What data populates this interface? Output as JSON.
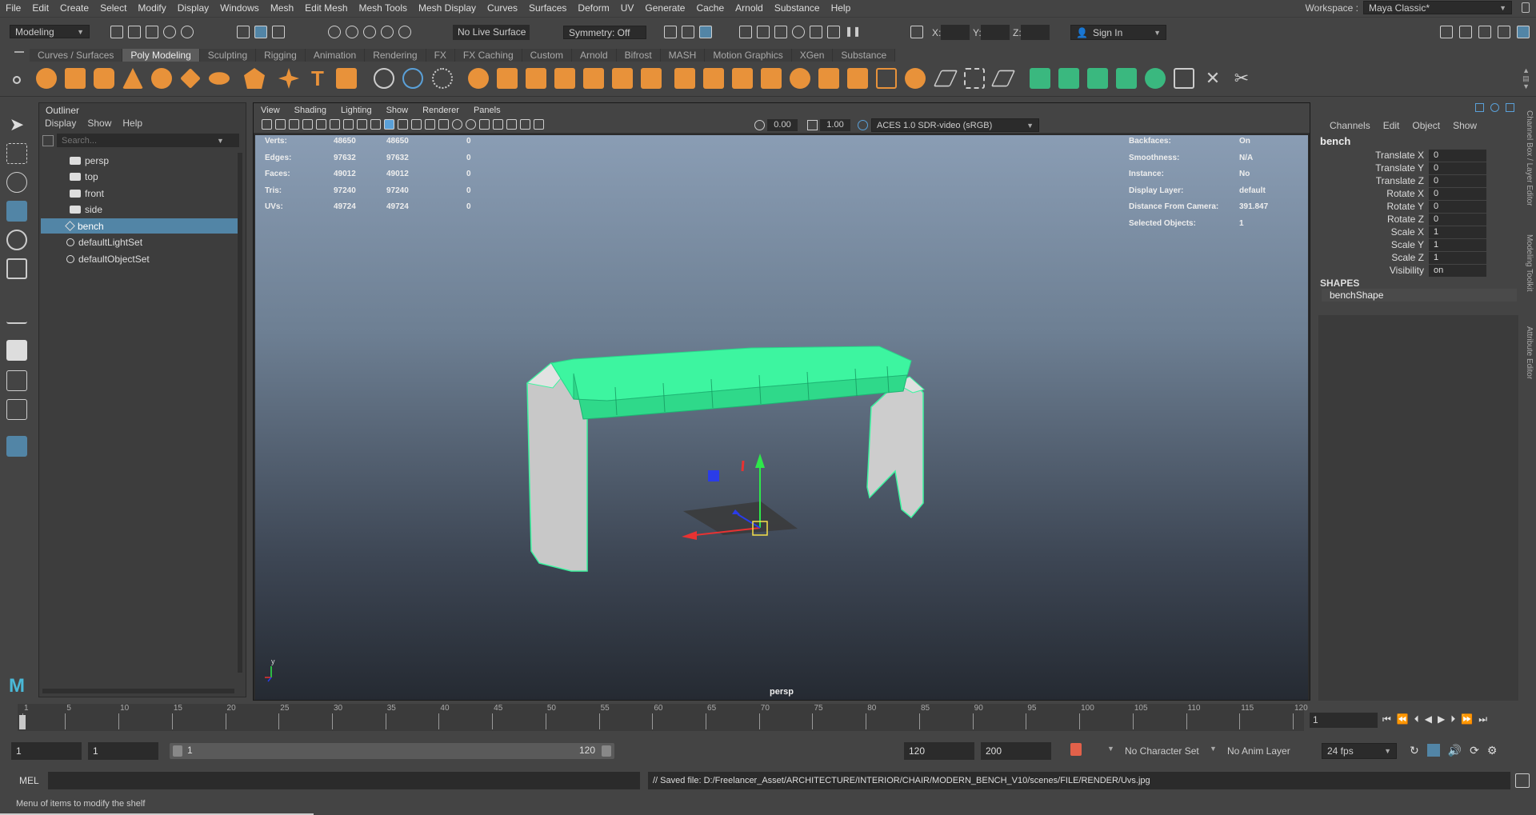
{
  "menubar": {
    "items": [
      "File",
      "Edit",
      "Create",
      "Select",
      "Modify",
      "Display",
      "Windows",
      "Mesh",
      "Edit Mesh",
      "Mesh Tools",
      "Mesh Display",
      "Curves",
      "Surfaces",
      "Deform",
      "UV",
      "Generate",
      "Cache",
      "Arnold",
      "Substance",
      "Help"
    ],
    "workspace_label": "Workspace :",
    "workspace_value": "Maya Classic*"
  },
  "statusline": {
    "mode": "Modeling",
    "live_surface": "No Live Surface",
    "symmetry": "Symmetry: Off",
    "x_label": "X:",
    "y_label": "Y:",
    "z_label": "Z:",
    "sign_in": "Sign In"
  },
  "shelf": {
    "tabs": [
      "Curves / Surfaces",
      "Poly Modeling",
      "Sculpting",
      "Rigging",
      "Animation",
      "Rendering",
      "FX",
      "FX Caching",
      "Custom",
      "Arnold",
      "Bifrost",
      "MASH",
      "Motion Graphics",
      "XGen",
      "Substance"
    ],
    "active_tab": "Poly Modeling"
  },
  "outliner": {
    "title": "Outliner",
    "menus": [
      "Display",
      "Show",
      "Help"
    ],
    "search_placeholder": "Search...",
    "items": [
      {
        "label": "persp",
        "icon": "camera-icon",
        "selected": false
      },
      {
        "label": "top",
        "icon": "camera-icon",
        "selected": false
      },
      {
        "label": "front",
        "icon": "camera-icon",
        "selected": false
      },
      {
        "label": "side",
        "icon": "camera-icon",
        "selected": false
      },
      {
        "label": "bench",
        "icon": "mesh-transform-icon",
        "selected": true
      },
      {
        "label": "defaultLightSet",
        "icon": "set-icon",
        "selected": false
      },
      {
        "label": "defaultObjectSet",
        "icon": "set-icon",
        "selected": false
      }
    ]
  },
  "viewport": {
    "menus": [
      "View",
      "Shading",
      "Lighting",
      "Show",
      "Renderer",
      "Panels"
    ],
    "exposure": "0.00",
    "gamma": "1.00",
    "color_space": "ACES 1.0 SDR-video (sRGB)",
    "camera_label": "persp",
    "axis_y": "y",
    "hud_left": [
      {
        "label": "Verts:",
        "a": "48650",
        "b": "48650",
        "c": "0"
      },
      {
        "label": "Edges:",
        "a": "97632",
        "b": "97632",
        "c": "0"
      },
      {
        "label": "Faces:",
        "a": "49012",
        "b": "49012",
        "c": "0"
      },
      {
        "label": "Tris:",
        "a": "97240",
        "b": "97240",
        "c": "0"
      },
      {
        "label": "UVs:",
        "a": "49724",
        "b": "49724",
        "c": "0"
      }
    ],
    "hud_right": [
      {
        "label": "Backfaces:",
        "value": "On"
      },
      {
        "label": "Smoothness:",
        "value": "N/A"
      },
      {
        "label": "Instance:",
        "value": "No"
      },
      {
        "label": "Display Layer:",
        "value": "default"
      },
      {
        "label": "Distance From Camera:",
        "value": "391.847"
      },
      {
        "label": "Selected Objects:",
        "value": "1"
      }
    ],
    "wire_color": "#3df5a0"
  },
  "channelbox": {
    "menus": [
      "Channels",
      "Edit",
      "Object",
      "Show"
    ],
    "object_name": "bench",
    "attributes": [
      {
        "label": "Translate X",
        "value": "0"
      },
      {
        "label": "Translate Y",
        "value": "0"
      },
      {
        "label": "Translate Z",
        "value": "0"
      },
      {
        "label": "Rotate X",
        "value": "0"
      },
      {
        "label": "Rotate Y",
        "value": "0"
      },
      {
        "label": "Rotate Z",
        "value": "0"
      },
      {
        "label": "Scale X",
        "value": "1"
      },
      {
        "label": "Scale Y",
        "value": "1"
      },
      {
        "label": "Scale Z",
        "value": "1"
      },
      {
        "label": "Visibility",
        "value": "on"
      }
    ],
    "shapes_heading": "SHAPES",
    "shape_name": "benchShape",
    "side_tabs": [
      "Channel Box / Layer Editor",
      "Modeling Toolkit",
      "Attribute Editor"
    ]
  },
  "timeslider": {
    "ticks": [
      "1",
      "5",
      "10",
      "15",
      "20",
      "25",
      "30",
      "35",
      "40",
      "45",
      "50",
      "55",
      "60",
      "65",
      "70",
      "75",
      "80",
      "85",
      "90",
      "95",
      "100",
      "105",
      "110",
      "115",
      "120"
    ],
    "current_frame": "1"
  },
  "rangeslider": {
    "start": "1",
    "anim_start": "1",
    "range_start": "1",
    "range_end": "120",
    "anim_end": "120",
    "end": "200",
    "character_set": "No Character Set",
    "anim_layer": "No Anim Layer",
    "fps": "24 fps"
  },
  "cmdline": {
    "lang": "MEL",
    "result": "// Saved file: D:/Freelancer_Asset/ARCHITECTURE/INTERIOR/CHAIR/MODERN_BENCH_V10/scenes/FILE/RENDER/Uvs.jpg"
  },
  "helpline": {
    "text": "Menu of items to modify the shelf"
  }
}
